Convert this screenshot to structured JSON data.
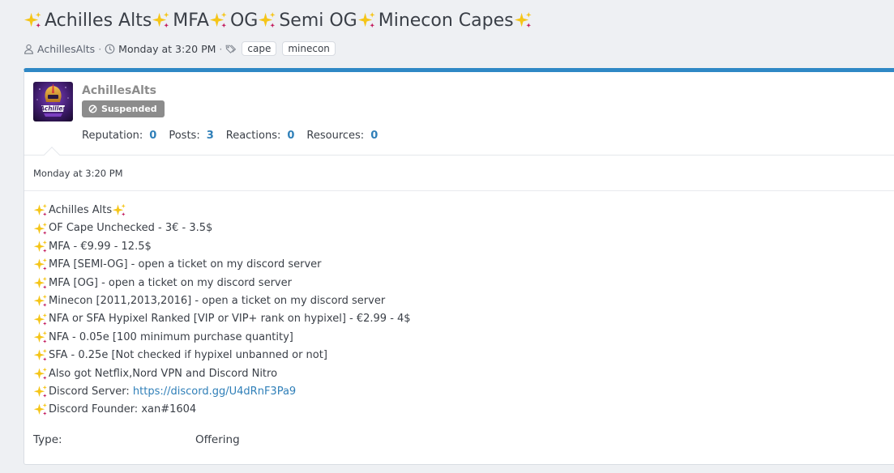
{
  "thread": {
    "title_segments": [
      "Achilles Alts ",
      " MFA",
      " OG ",
      "Semi OG ",
      " Minecon Capes"
    ],
    "author": "AchillesAlts",
    "separator": "·",
    "time": "Monday at 3:20 PM",
    "tags": [
      "cape",
      "minecon"
    ]
  },
  "post": {
    "username": "AchillesAlts",
    "badge": "Suspended",
    "stats": [
      {
        "label": "Reputation:",
        "value": "0"
      },
      {
        "label": "Posts:",
        "value": "3"
      },
      {
        "label": "Reactions:",
        "value": "0"
      },
      {
        "label": "Resources:",
        "value": "0"
      }
    ],
    "date": "Monday at 3:20 PM",
    "lines": [
      " Achilles Alts",
      "OF Cape Unchecked - 3€ - 3.5$",
      "MFA - €9.99 - 12.5$",
      "MFA [SEMI-OG] - open a ticket on my discord server",
      "MFA [OG] - open a ticket on my discord server",
      "Minecon [2011,2013,2016] - open a ticket on my discord server",
      "NFA or SFA Hypixel Ranked [VIP or VIP+ rank on hypixel] - €2.99 - 4$",
      "NFA - 0.05e [100 minimum purchase quantity]",
      "SFA - 0.25e [Not checked if hypixel unbanned or not]",
      "Also got Netflix,Nord VPN and Discord Nitro",
      "Discord Server: ",
      "Discord Founder: xan#1604"
    ],
    "discord_link": "https://discord.gg/U4dRnF3Pa9",
    "field": {
      "label": "Type:",
      "value": "Offering"
    }
  },
  "icons": {
    "sparkle": "sparkles-icon",
    "user": "user-icon",
    "clock": "clock-icon",
    "tags": "tags-icon",
    "ban": "ban-icon"
  },
  "colors": {
    "accent": "#2f88c5",
    "link": "#2f7fb8",
    "badge": "#8c8c8c",
    "sparkle": "#f5c518"
  }
}
